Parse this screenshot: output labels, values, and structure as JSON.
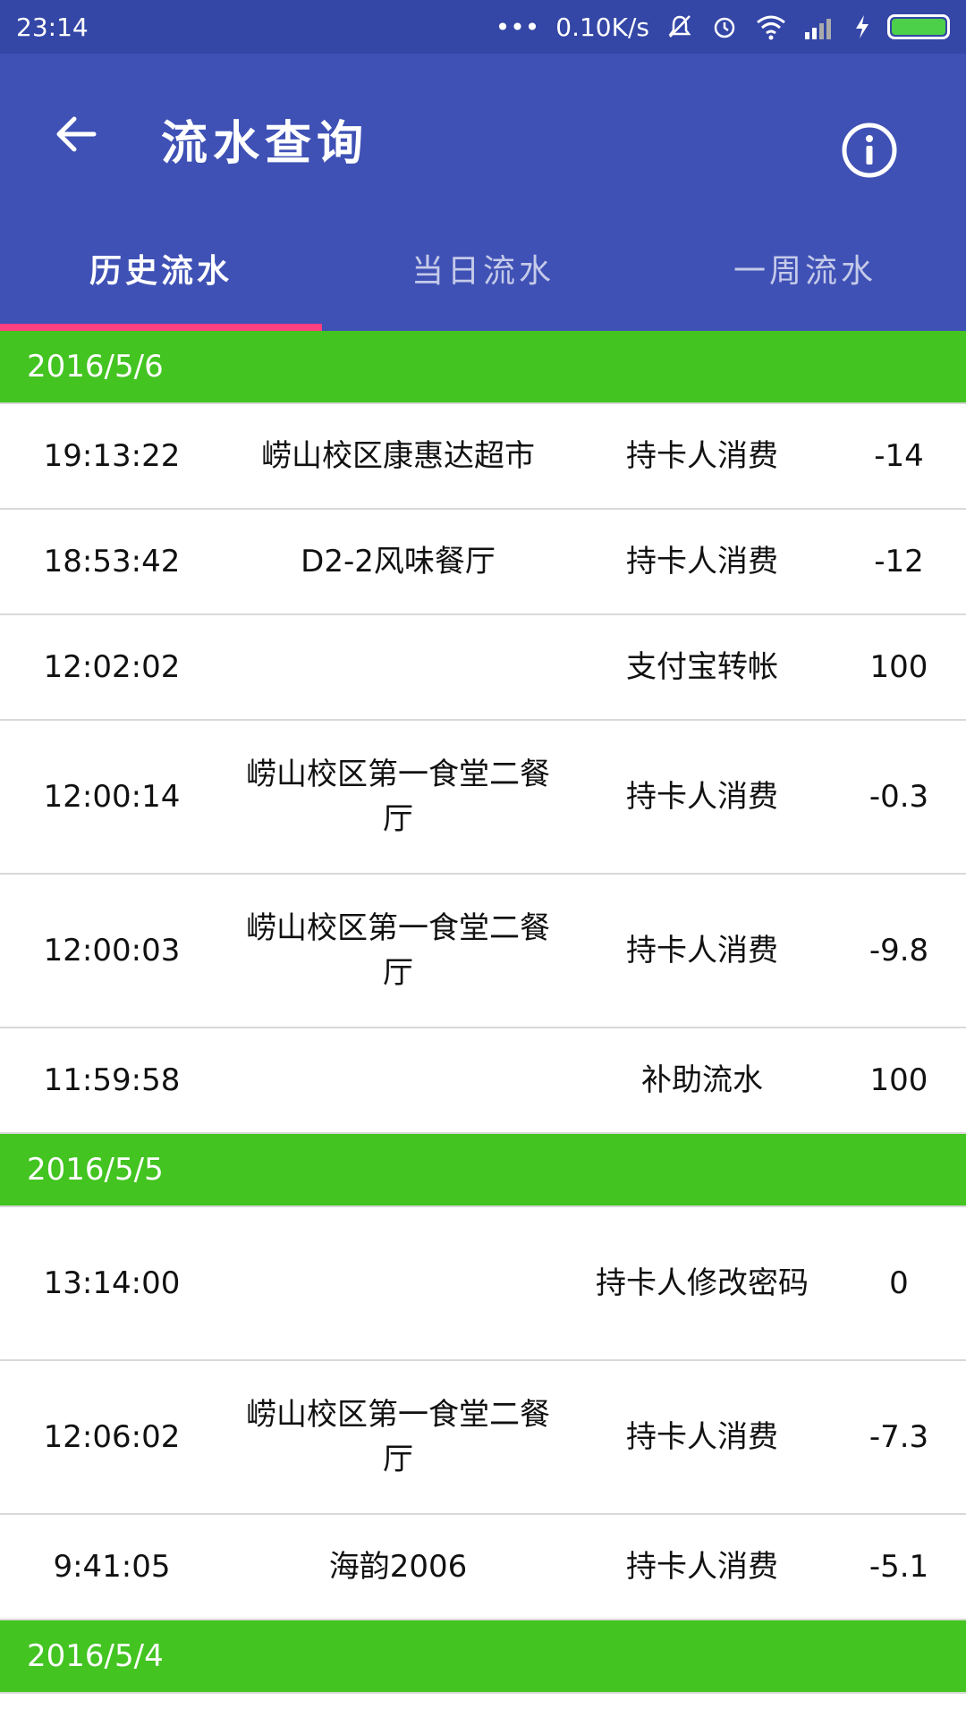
{
  "status_bar": {
    "time": "23:14",
    "dots": "•••",
    "speed": "0.10K/s"
  },
  "toolbar": {
    "title": "流水查询"
  },
  "tabs": [
    "历史流水",
    "当日流水",
    "一周流水"
  ],
  "groups": [
    {
      "date": "2016/5/6",
      "rows": [
        {
          "time": "19:13:22",
          "place": "崂山校区康惠达超市",
          "type": "持卡人消费",
          "amount": "-14"
        },
        {
          "time": "18:53:42",
          "place": "D2-2风味餐厅",
          "type": "持卡人消费",
          "amount": "-12"
        },
        {
          "time": "12:02:02",
          "place": "",
          "type": "支付宝转帐",
          "amount": "100"
        },
        {
          "time": "12:00:14",
          "place": "崂山校区第一食堂二餐厅",
          "type": "持卡人消费",
          "amount": "-0.3"
        },
        {
          "time": "12:00:03",
          "place": "崂山校区第一食堂二餐厅",
          "type": "持卡人消费",
          "amount": "-9.8"
        },
        {
          "time": "11:59:58",
          "place": "",
          "type": "补助流水",
          "amount": "100"
        }
      ]
    },
    {
      "date": "2016/5/5",
      "rows": [
        {
          "time": "13:14:00",
          "place": "",
          "type": "持卡人修改密码",
          "amount": "0"
        },
        {
          "time": "12:06:02",
          "place": "崂山校区第一食堂二餐厅",
          "type": "持卡人消费",
          "amount": "-7.3"
        },
        {
          "time": "9:41:05",
          "place": "海韵2006",
          "type": "持卡人消费",
          "amount": "-5.1"
        }
      ]
    },
    {
      "date": "2016/5/4",
      "rows": []
    }
  ]
}
